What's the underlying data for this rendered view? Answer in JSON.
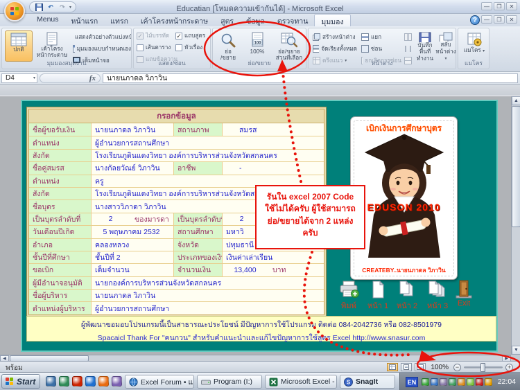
{
  "window": {
    "title": "Educatian  [โหมดความเข้ากันได้] - Microsoft Excel"
  },
  "tabs": {
    "items": [
      "Menus",
      "หน้าแรก",
      "แทรก",
      "เค้าโครงหน้ากระดาษ",
      "สูตร",
      "ข้อมูล",
      "ตรวจทาน",
      "มุมมอง"
    ],
    "active_index": 7
  },
  "ribbon": {
    "workbook_views": {
      "title": "มุมมองสมุดงาน",
      "normal": "ปกติ",
      "page_layout": "เค้าโครง\nหน้ากระดาษ",
      "small_buttons": [
        "แสดงตัวอย่างตัวแบ่งหน้า",
        "มุมมองแบบกำหนดเอง",
        "เต็มหน้าจอ"
      ]
    },
    "show_hide": {
      "title": "แสดง/ซ่อน",
      "checkboxes": [
        {
          "label": "ไม้บรรทัด",
          "checked": true,
          "disabled": true
        },
        {
          "label": "เส้นตาราง",
          "checked": false,
          "disabled": false
        },
        {
          "label": "แถบข้อความ",
          "checked": false,
          "disabled": true
        },
        {
          "label": "แถบสูตร",
          "checked": true,
          "disabled": false
        },
        {
          "label": "หัวเรื่อง",
          "checked": false,
          "disabled": false
        }
      ]
    },
    "zoom": {
      "title": "ย่อ/ขยาย",
      "zoom_l1": "ย่อ",
      "zoom_l2": "/ขยาย",
      "hundred": "100%",
      "sel_l1": "ย่อ/ขยาย",
      "sel_l2": "ส่วนที่เลือก"
    },
    "window_group": {
      "title": "หน้าต่าง",
      "col1": [
        "สร้างหน้าต่าง",
        "จัดเรียงทั้งหมด",
        "ตรึงแนว"
      ],
      "col2": [
        "แยก",
        "ซ่อน",
        "ยกเลิกการซ่อน"
      ],
      "save_l1": "บันทึกพื้นที่",
      "save_l2": "ทำงาน",
      "switch_l1": "สลับ",
      "switch_l2": "หน้าต่าง"
    },
    "macro": {
      "title": "แมโคร",
      "button": "แมโคร"
    }
  },
  "formula_bar": {
    "name_box": "D4",
    "fx": "fx",
    "value": "นายนภาดล  วิภาวิน"
  },
  "form": {
    "header": "กรอกข้อมูล",
    "rows": [
      {
        "cells": [
          {
            "t": "label",
            "text": "ชื่อผู้ขอรับเงิน"
          },
          {
            "t": "value",
            "text": "นายนภาดล  วิภาวิน"
          },
          {
            "t": "label",
            "text": "สถานภาพ"
          },
          {
            "t": "value",
            "text": "สมรส",
            "pad": 24
          }
        ]
      },
      {
        "cells": [
          {
            "t": "label",
            "text": "ตำแหน่ง"
          },
          {
            "t": "value",
            "text": "ผู้อำนวยการสถานศึกษา",
            "span": 3
          }
        ]
      },
      {
        "cells": [
          {
            "t": "label",
            "text": "สังกัด"
          },
          {
            "t": "value",
            "text": "โรงเรียนภูดินแดงวิทยา   องค์การบริหารส่วนจังหวัดสกลนคร",
            "span": 3
          }
        ]
      },
      {
        "cells": [
          {
            "t": "label",
            "text": "ชื่อคู่สมรส"
          },
          {
            "t": "value",
            "text": "นางกัลยวัณย์  วิภาวิน"
          },
          {
            "t": "label",
            "text": "อาชีพ"
          },
          {
            "t": "value",
            "text": "-",
            "pad": 24
          }
        ]
      },
      {
        "cells": [
          {
            "t": "label",
            "text": "ตำแหน่ง"
          },
          {
            "t": "value",
            "text": "ครู",
            "span": 3
          }
        ]
      },
      {
        "cells": [
          {
            "t": "label",
            "text": "สังกัด"
          },
          {
            "t": "value",
            "text": "โรงเรียนภูดินแดงวิทยา องค์การบริหารส่วนจังหวัดสกลนคร",
            "span": 3
          }
        ]
      },
      {
        "cells": [
          {
            "t": "label",
            "text": "ชื่อบุตร"
          },
          {
            "t": "value",
            "text": "นางสาววิภาดา  วิภาวิน",
            "span": 3
          }
        ]
      },
      {
        "cells": [
          {
            "t": "label",
            "text": "เป็นบุตรลำดับที่"
          },
          {
            "t": "value",
            "text": "2",
            "suffix": "ของมารดา",
            "vwidth": 45
          },
          {
            "t": "label",
            "text": "เป็นบุตรลำดับที่"
          },
          {
            "t": "value",
            "text": "2",
            "vwidth": 45
          }
        ]
      },
      {
        "cells": [
          {
            "t": "label",
            "text": "วันเดือนปีเกิด"
          },
          {
            "t": "value",
            "text": "5 พฤษภาคม 2532",
            "vwidth": 105
          },
          {
            "t": "label",
            "text": "สถานศึกษา"
          },
          {
            "t": "value",
            "text": "มหาวิ"
          }
        ]
      },
      {
        "cells": [
          {
            "t": "label",
            "text": "อำเภอ"
          },
          {
            "t": "value",
            "text": "คลองหลวง"
          },
          {
            "t": "label",
            "text": "จังหวัด"
          },
          {
            "t": "value",
            "text": "ปทุมธานี"
          }
        ]
      },
      {
        "cells": [
          {
            "t": "label",
            "text": "ชั้นปีที่ศึกษา"
          },
          {
            "t": "value",
            "text": "ชั้นปีที่ 2"
          },
          {
            "t": "label",
            "text": "ประเภทของเงิน"
          },
          {
            "t": "value",
            "text": "เงินค่าเล่าเรียน"
          }
        ]
      },
      {
        "cells": [
          {
            "t": "label",
            "text": "ขอเบิก"
          },
          {
            "t": "value",
            "text": "เต็มจำนวน"
          },
          {
            "t": "label",
            "text": "จำนวนเงิน"
          },
          {
            "t": "value",
            "text": "13,400",
            "suffix": "บาท",
            "vwidth": 55
          }
        ]
      },
      {
        "cells": [
          {
            "t": "label",
            "text": "ผู้มีอำนาจอนุมัติ"
          },
          {
            "t": "value",
            "text": "นายกองค์การบริหารส่วนจังหวัดสกลนคร",
            "span": 3
          }
        ]
      },
      {
        "cells": [
          {
            "t": "label",
            "text": "ชื่อผู้บริหาร"
          },
          {
            "t": "value",
            "text": "นายนภาดล  วิภาวิน",
            "span": 3
          }
        ]
      },
      {
        "cells": [
          {
            "t": "label",
            "text": "ตำแหน่งผู้บริหาร"
          },
          {
            "t": "value",
            "text": "ผู้อำนวยการสถานศึกษา",
            "span": 3
          }
        ]
      }
    ]
  },
  "panel": {
    "title": "เบิกเงินการศึกษาบุตร",
    "banner": "EDUSON 2010",
    "credit": "CREATEBY..นายนภาดล  วิภาวิน",
    "buttons": [
      {
        "icon": "printer-icon",
        "label": "พิมพ์"
      },
      {
        "icon": "page-icon",
        "label": "หน้า 1"
      },
      {
        "icon": "pages-2-icon",
        "label": "หน้า 2"
      },
      {
        "icon": "pages-3-icon",
        "label": "หน้า 3"
      },
      {
        "icon": "door-icon",
        "label": "Exit"
      }
    ]
  },
  "callout": {
    "lines": [
      "รันใน excel 2007 Code",
      "ใช้ไม่ได้ครับ ผู้ใช้สามารถ",
      "ย่อ/ขยายได้จาก 2 แหล่ง",
      "ครับ"
    ]
  },
  "footer_note": {
    "line1": "ผู้พัฒนาขอมอบโปรแกรมนี้เป็นสาธารณะประโยชน์ มีปัญหาการใช้โปรแกรม ติดต่อ 084-2042736 หรือ 082-8501979",
    "line2": "Spacaicl Thank For \"คนกวน\"  สำหรับคำแนะนำและแก้ไขปัญหาการใช้สูตร Excel http://www.snasur.com"
  },
  "status_bar": {
    "ready": "พร้อม",
    "zoom_level": "100%"
  },
  "taskbar": {
    "start": "Start",
    "quick_launch": [
      {
        "name": "quick-launch-1",
        "color": "#3a6ea5"
      },
      {
        "name": "quick-launch-2",
        "color": "#2e8b57"
      },
      {
        "name": "quick-launch-3",
        "color": "#cc2200"
      },
      {
        "name": "quick-launch-4",
        "color": "#1e6fd0"
      },
      {
        "name": "quick-launch-5",
        "color": "#e86a10"
      },
      {
        "name": "quick-launch-6",
        "color": "#7a5fb0"
      },
      {
        "name": "quick-launch-7",
        "color": "#c01818"
      }
    ],
    "overflow": "»",
    "buttons": [
      {
        "icon": "globe-icon",
        "label": "Excel Forum • แสด..."
      },
      {
        "icon": "drive-icon",
        "label": "Program (I:)"
      },
      {
        "icon": "excel-icon",
        "label": "Microsoft Excel - Ed..."
      },
      {
        "icon": "snagit-icon",
        "label": "SnagIt",
        "pressed": true
      }
    ],
    "tray": {
      "language": "EN",
      "time": "22:04",
      "icons": [
        {
          "name": "tray-1",
          "color": "#38a838"
        },
        {
          "name": "tray-2",
          "color": "#3a78c8"
        },
        {
          "name": "tray-3",
          "color": "#8878a8"
        },
        {
          "name": "tray-4",
          "color": "#40a060"
        },
        {
          "name": "tray-5",
          "color": "#e09020"
        },
        {
          "name": "tray-6",
          "color": "#80c840"
        },
        {
          "name": "tray-7",
          "color": "#d02020"
        },
        {
          "name": "tray-8",
          "color": "#e8a000"
        }
      ]
    }
  },
  "colors": {
    "teal_panel": "#00807a",
    "annotation_red": "#e8140c",
    "form_label_bg": "#d9f7cb",
    "form_value_text": "#2525cc",
    "form_label_text": "#993366",
    "footer_bg": "#ffffc4",
    "accent_orange": "#ff4d00"
  }
}
